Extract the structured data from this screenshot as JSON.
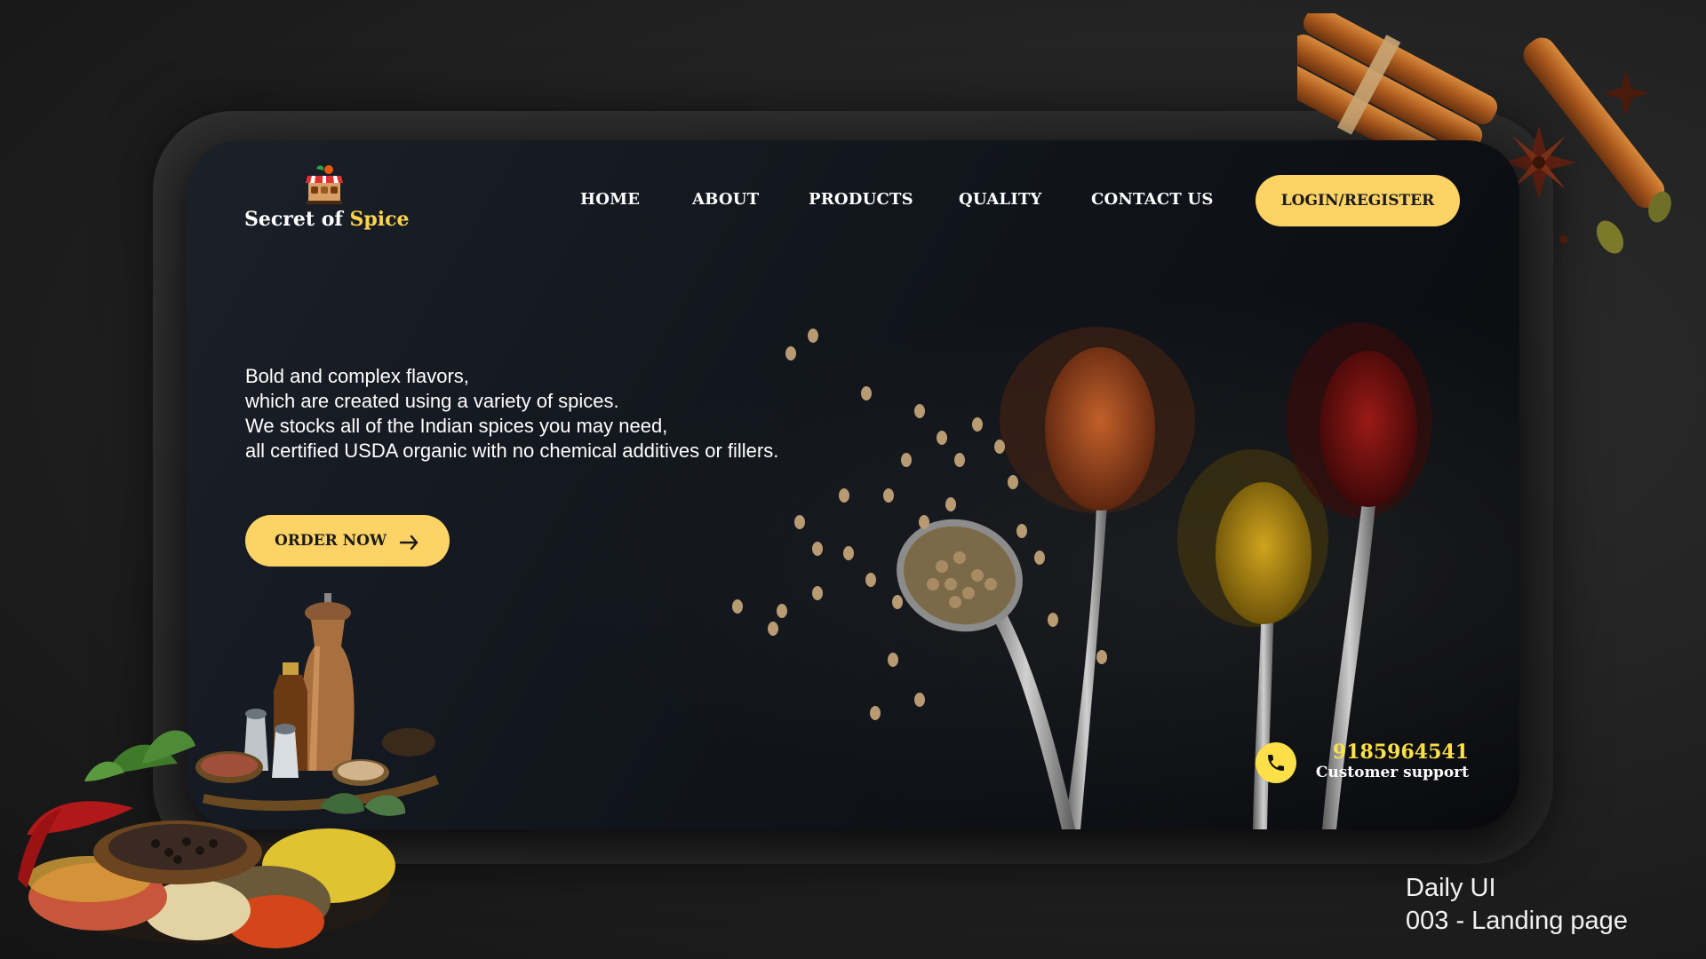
{
  "brand": {
    "name_part1": "Secret of ",
    "name_part2": "Spice"
  },
  "nav": {
    "items": [
      {
        "label": "HOME"
      },
      {
        "label": "ABOUT"
      },
      {
        "label": "PRODUCTS"
      },
      {
        "label": "QUALITY"
      },
      {
        "label": "CONTACT US"
      }
    ],
    "login_label": "LOGIN/REGISTER"
  },
  "hero": {
    "lines": [
      "Bold and complex flavors,",
      "which are created using a variety of spices.",
      "We stocks all of the Indian spices you may need,",
      "all certified USDA organic with no chemical additives or fillers."
    ],
    "cta_label": "ORDER NOW",
    "cta_icon": "arrow-right-icon"
  },
  "support": {
    "phone": "9185964541",
    "label": "Customer support",
    "icon": "phone-icon"
  },
  "caption": {
    "line1": "Daily UI",
    "line2": "003 - Landing page"
  },
  "colors": {
    "accent": "#fdd366",
    "phone_accent": "#fde047",
    "page_bg": "#232323",
    "card_bg": "#11151c"
  }
}
